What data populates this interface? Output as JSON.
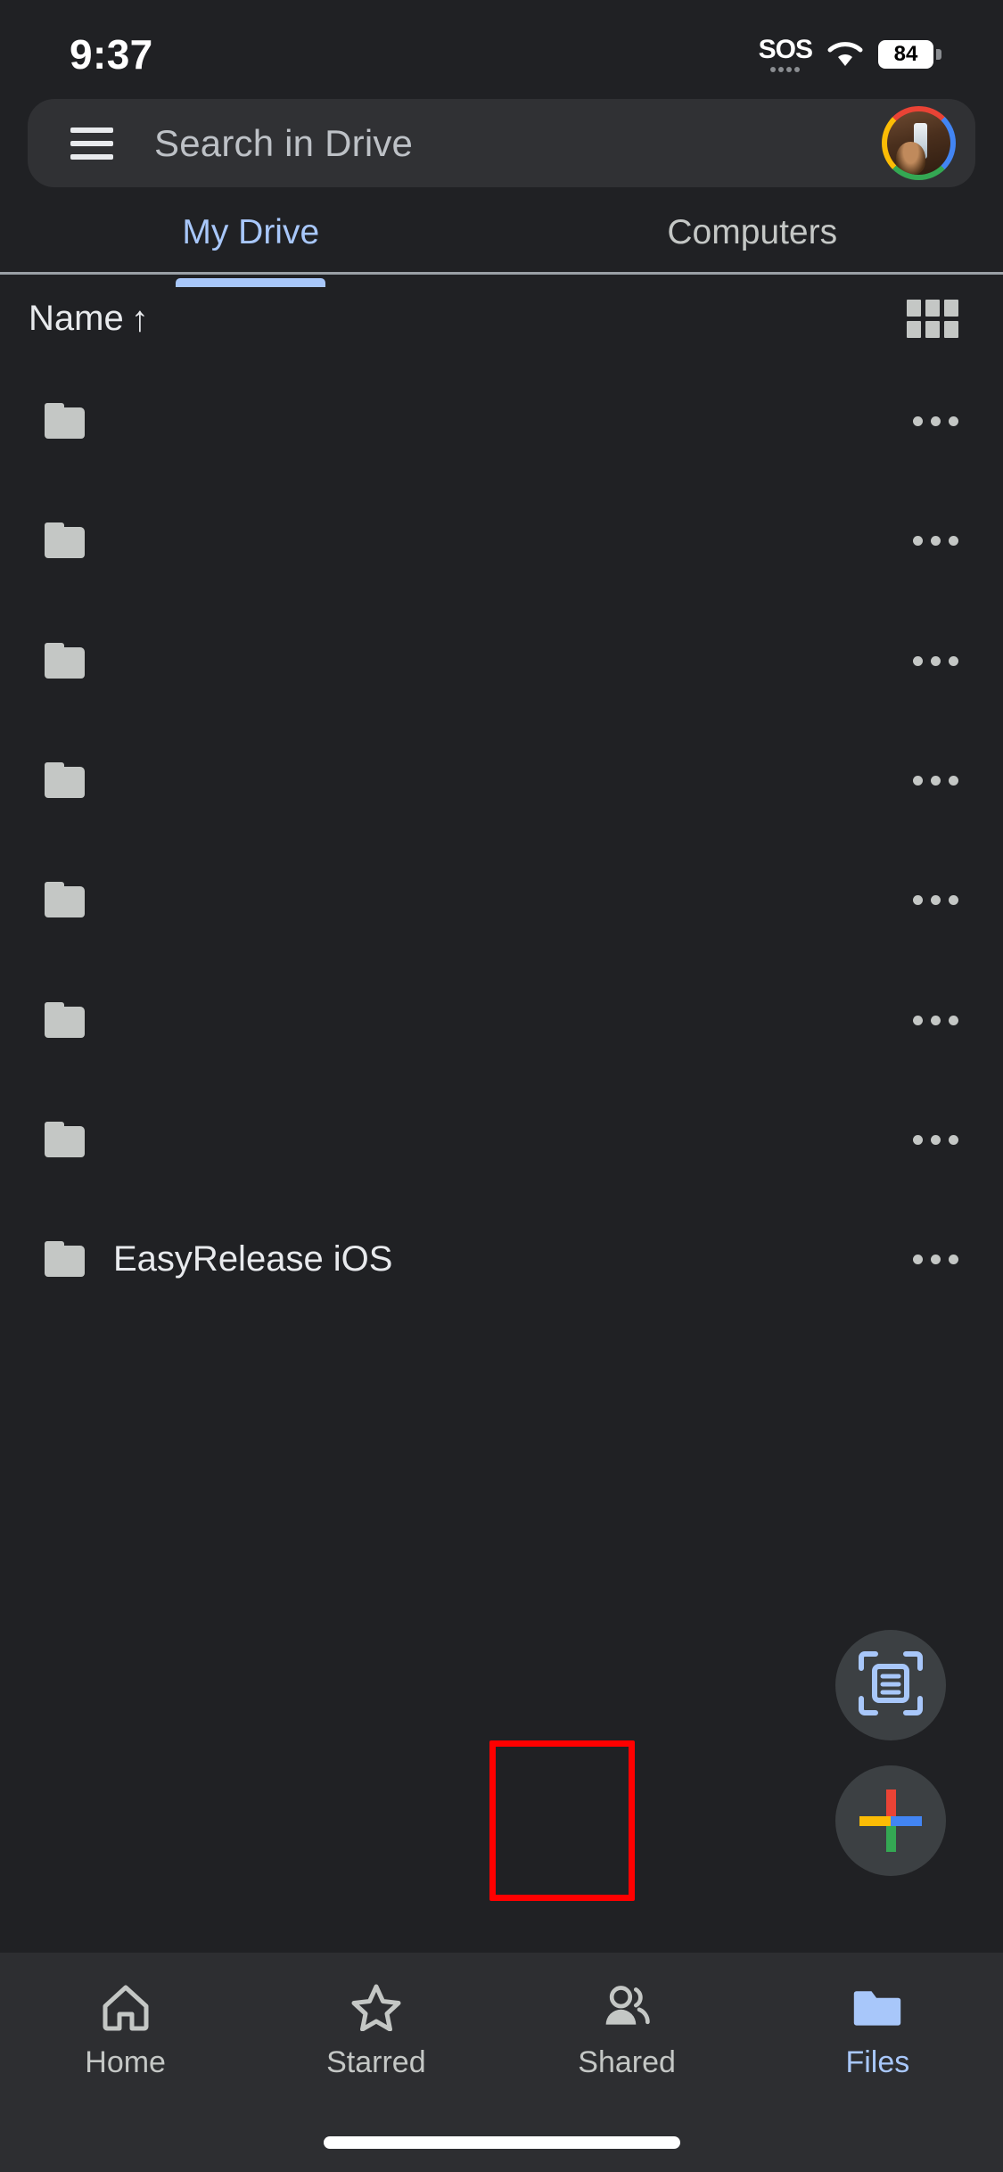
{
  "status_bar": {
    "time": "9:37",
    "sos_label": "SOS",
    "wifi_icon": "wifi-icon",
    "battery_level": "84"
  },
  "search": {
    "menu_icon": "hamburger-menu-icon",
    "placeholder": "Search in Drive",
    "value": "",
    "avatar_icon": "account-avatar"
  },
  "tabs": [
    {
      "label": "My Drive",
      "active": true
    },
    {
      "label": "Computers",
      "active": false
    }
  ],
  "sort": {
    "label": "Name",
    "direction_glyph": "↑",
    "view_toggle_icon": "grid-view-icon"
  },
  "files": [
    {
      "name": "",
      "icon": "folder-icon",
      "menu_icon": "overflow-menu-icon"
    },
    {
      "name": "",
      "icon": "folder-icon",
      "menu_icon": "overflow-menu-icon"
    },
    {
      "name": "",
      "icon": "folder-icon",
      "menu_icon": "overflow-menu-icon"
    },
    {
      "name": "",
      "icon": "folder-icon",
      "menu_icon": "overflow-menu-icon"
    },
    {
      "name": "",
      "icon": "folder-icon",
      "menu_icon": "overflow-menu-icon"
    },
    {
      "name": "",
      "icon": "folder-icon",
      "menu_icon": "overflow-menu-icon"
    },
    {
      "name": "",
      "icon": "folder-icon",
      "menu_icon": "overflow-menu-icon"
    },
    {
      "name": "EasyRelease iOS",
      "icon": "folder-icon",
      "menu_icon": "overflow-menu-icon"
    }
  ],
  "fabs": {
    "scan_icon": "document-scan-icon",
    "create_icon": "plus-icon",
    "highlight_color": "#ff0000"
  },
  "bottom_nav": [
    {
      "label": "Home",
      "icon": "home-icon",
      "active": false
    },
    {
      "label": "Starred",
      "icon": "star-icon",
      "active": false
    },
    {
      "label": "Shared",
      "icon": "people-icon",
      "active": false
    },
    {
      "label": "Files",
      "icon": "folder-icon",
      "active": true
    }
  ],
  "colors": {
    "background": "#202124",
    "surface": "#303134",
    "accent_blue": "#a8c7fa",
    "google_red": "#ea4335",
    "google_yellow": "#fbbc05",
    "google_green": "#34a853",
    "google_blue": "#4285f4"
  }
}
